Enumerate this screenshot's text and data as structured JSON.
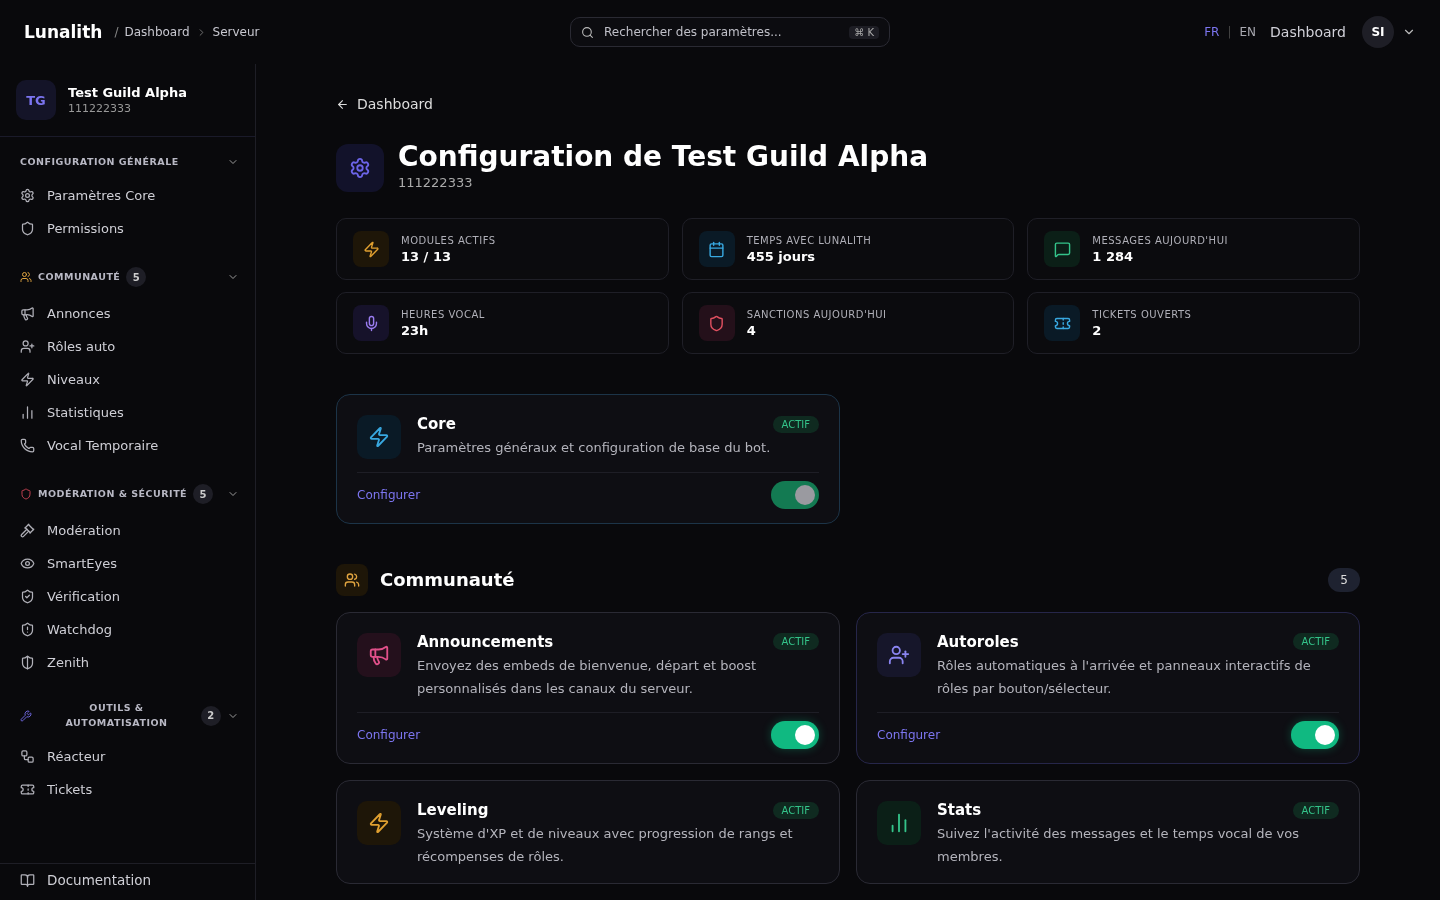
{
  "header": {
    "brand": "Lunalith",
    "breadcrumb_prefix": "/",
    "breadcrumb": [
      "Dashboard",
      "Serveur"
    ],
    "language_separator": "|",
    "search": {
      "placeholder": "Rechercher des paramètres...",
      "shortcut": "⌘ K"
    },
    "languages": [
      {
        "label": "FR",
        "selected": true
      },
      {
        "label": "EN",
        "selected": false
      }
    ],
    "nav_link": "Dashboard",
    "avatar": "SI"
  },
  "sidebar": {
    "guild": {
      "initials": "TG",
      "name": "Test Guild Alpha",
      "id": "111222333"
    },
    "groups": [
      {
        "title": "CONFIGURATION GÉNÉRALE",
        "expanded": true,
        "items": [
          "Paramètres Core",
          "Permissions"
        ]
      },
      {
        "title": "COMMUNAUTÉ",
        "count": "5",
        "expanded": true,
        "items": [
          "Annonces",
          "Rôles auto",
          "Niveaux",
          "Statistiques",
          "Vocal Temporaire"
        ]
      },
      {
        "title": "MODÉRATION & SÉCURITÉ",
        "count": "5",
        "expanded": true,
        "items": [
          "Modération",
          "SmartEyes",
          "Vérification",
          "Watchdog",
          "Zenith"
        ]
      },
      {
        "title": "OUTILS & AUTOMATISATION",
        "count": "2",
        "expanded": true,
        "items": [
          "Réacteur",
          "Tickets"
        ]
      }
    ],
    "footer_link": "Documentation"
  },
  "page": {
    "back_link": "Dashboard",
    "title": "Configuration de Test Guild Alpha",
    "subtitle": "111222333",
    "stats": [
      {
        "label": "MODULES ACTIFS",
        "value": "13 / 13"
      },
      {
        "label": "TEMPS AVEC LUNALITH",
        "value": "455 jours"
      },
      {
        "label": "MESSAGES AUJOURD'HUI",
        "value": "1 284"
      },
      {
        "label": "HEURES VOCAL",
        "value": "23h"
      },
      {
        "label": "SANCTIONS AUJOURD'HUI",
        "value": "4"
      },
      {
        "label": "TICKETS OUVERTS",
        "value": "2"
      }
    ],
    "core_module": {
      "name": "Core",
      "status": "ACTIF",
      "description": "Paramètres généraux et configuration de base du bot.",
      "action": "Configurer",
      "on": true,
      "disabled": true
    },
    "sections": [
      {
        "title": "Communauté",
        "count": "5",
        "modules": [
          {
            "name": "Announcements",
            "status": "ACTIF",
            "description": "Envoyez des embeds de bienvenue, départ et boost personnalisés dans les canaux du serveur.",
            "action": "Configurer",
            "on": true,
            "disabled": false
          },
          {
            "name": "Autoroles",
            "status": "ACTIF",
            "description": "Rôles automatiques à l'arrivée et panneaux interactifs de rôles par bouton/sélecteur.",
            "action": "Configurer",
            "on": true,
            "disabled": false
          },
          {
            "name": "Leveling",
            "status": "ACTIF",
            "description": "Système d'XP et de niveaux avec progression de rangs et récompenses de rôles."
          },
          {
            "name": "Stats",
            "status": "ACTIF",
            "description": "Suivez l'activité des messages et le temps vocal de vos membres."
          }
        ]
      }
    ]
  }
}
